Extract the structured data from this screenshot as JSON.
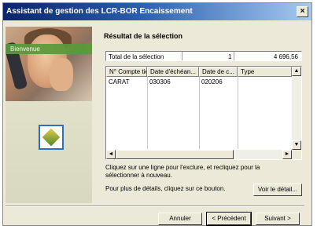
{
  "window": {
    "title": "Assistant de gestion des LCR-BOR Encaissement",
    "close_glyph": "×"
  },
  "left_panel": {
    "banner_label": "Bienvenue"
  },
  "section_title": "Résultat de la sélection",
  "total": {
    "label": "Total de la sélection",
    "count": "1",
    "amount": "4 696,56"
  },
  "list": {
    "columns": [
      "N° Compte tiers",
      "Date d'échéan...",
      "Date de c...",
      "Type"
    ],
    "rows": [
      [
        "CARAT",
        "030306",
        "020206",
        ""
      ]
    ]
  },
  "help": {
    "line1": "Cliquez sur une ligne pour l'exclure, et recliquez pour la sélectionner à nouveau.",
    "line2": "Pour plus de détails, cliquez sur ce bouton."
  },
  "buttons": {
    "details": "Voir le détail...",
    "cancel": "Annuler",
    "previous": "< Précédent",
    "next": "Suivant >"
  },
  "scroll_glyphs": {
    "up": "▲",
    "down": "▼",
    "left": "◄",
    "right": "►"
  }
}
